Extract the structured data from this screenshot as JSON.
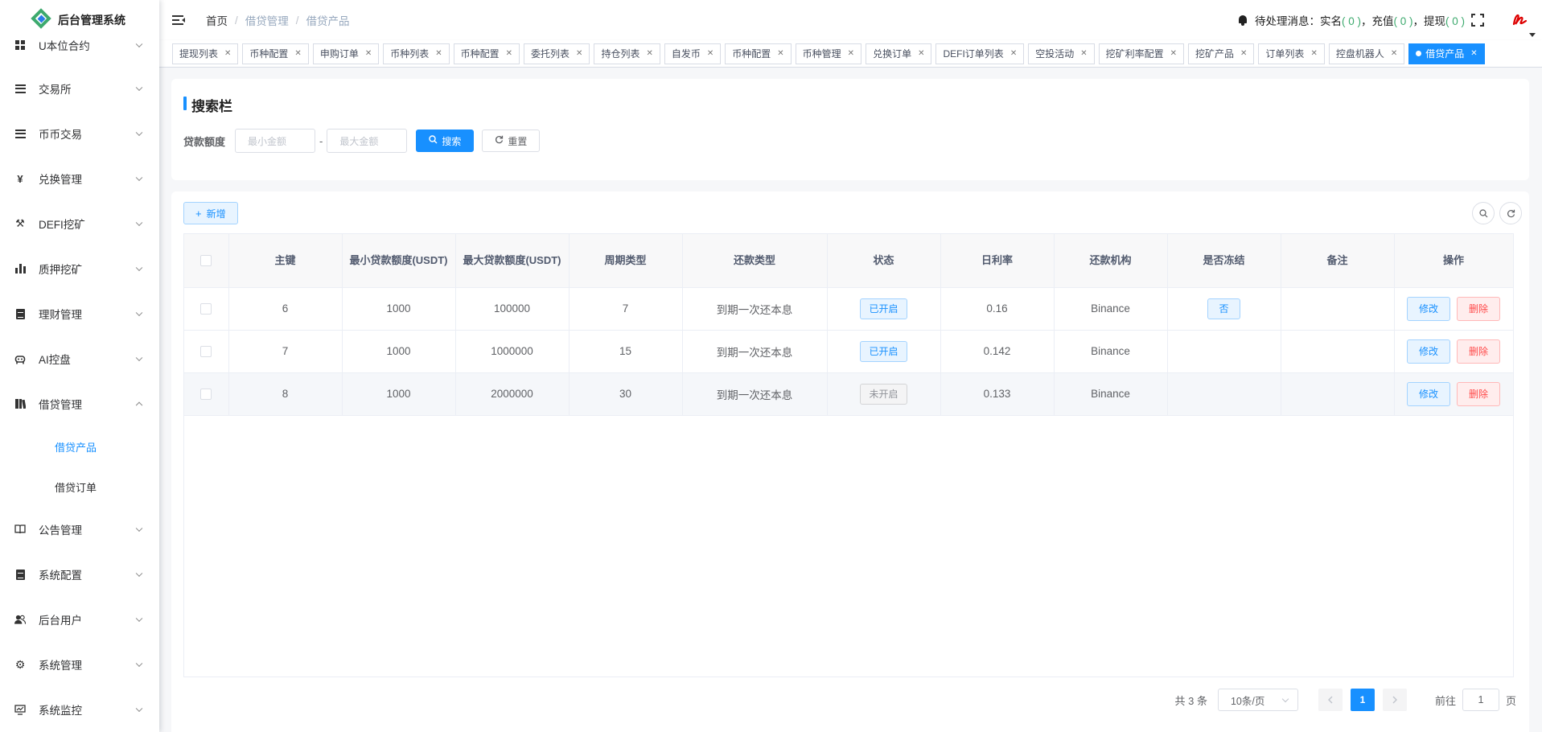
{
  "app": {
    "title": "后台管理系统"
  },
  "sidebar": {
    "items": [
      {
        "label": "U本位合约",
        "icon": "grid-icon"
      },
      {
        "label": "交易所",
        "icon": "list-icon"
      },
      {
        "label": "币币交易",
        "icon": "list-icon"
      },
      {
        "label": "兑换管理",
        "icon": "yen-icon"
      },
      {
        "label": "DEFI挖矿",
        "icon": "pickaxe-icon"
      },
      {
        "label": "质押挖矿",
        "icon": "bar-chart-icon"
      },
      {
        "label": "理财管理",
        "icon": "document-icon"
      },
      {
        "label": "AI控盘",
        "icon": "robot-icon"
      },
      {
        "label": "借贷管理",
        "icon": "book-icon"
      },
      {
        "label": "公告管理",
        "icon": "open-book-icon"
      },
      {
        "label": "系统配置",
        "icon": "document-icon"
      },
      {
        "label": "后台用户",
        "icon": "users-icon"
      },
      {
        "label": "系统管理",
        "icon": "gear-icon"
      },
      {
        "label": "系统监控",
        "icon": "monitor-icon"
      }
    ],
    "submenu": [
      {
        "label": "借贷产品"
      },
      {
        "label": "借贷订单"
      }
    ]
  },
  "header": {
    "breadcrumb": [
      "首页",
      "借贷管理",
      "借贷产品"
    ],
    "pending_label": "待处理消息：",
    "realname_label": "实名",
    "realname_count": "( 0 )",
    "sep1": "，",
    "recharge_label": "充值",
    "recharge_count": "( 0 )",
    "sep2": "，",
    "withdraw_label": "提现",
    "withdraw_count": "( 0 )"
  },
  "tags": [
    "提现列表",
    "币种配置",
    "申购订单",
    "币种列表",
    "币种配置",
    "委托列表",
    "持仓列表",
    "自发币",
    "币种配置",
    "币种管理",
    "兑换订单",
    "DEFI订单列表",
    "空投活动",
    "挖矿利率配置",
    "挖矿产品",
    "订单列表",
    "控盘机器人",
    "借贷产品"
  ],
  "search": {
    "title": "搜索栏",
    "label": "贷款额度",
    "min_placeholder": "最小金额",
    "dash": "-",
    "max_placeholder": "最大金额",
    "search_btn": "搜索",
    "reset_btn": "重置"
  },
  "toolbar": {
    "add_btn": "新增"
  },
  "table": {
    "headers": [
      "主键",
      "最小贷款额度(USDT)",
      "最大贷款额度(USDT)",
      "周期类型",
      "还款类型",
      "状态",
      "日利率",
      "还款机构",
      "是否冻结",
      "备注",
      "操作"
    ],
    "rows": [
      {
        "id": "6",
        "min": "1000",
        "max": "100000",
        "period": "7",
        "repay": "到期一次还本息",
        "status": "已开启",
        "status_on": true,
        "rate": "0.16",
        "org": "Binance",
        "frozen": "否",
        "remark": ""
      },
      {
        "id": "7",
        "min": "1000",
        "max": "1000000",
        "period": "15",
        "repay": "到期一次还本息",
        "status": "已开启",
        "status_on": true,
        "rate": "0.142",
        "org": "Binance",
        "frozen": "",
        "remark": ""
      },
      {
        "id": "8",
        "min": "1000",
        "max": "2000000",
        "period": "30",
        "repay": "到期一次还本息",
        "status": "未开启",
        "status_on": false,
        "rate": "0.133",
        "org": "Binance",
        "frozen": "",
        "remark": ""
      }
    ],
    "edit_btn": "修改",
    "delete_btn": "删除"
  },
  "pagination": {
    "total": "共 3 条",
    "page_size": "10条/页",
    "current": "1",
    "goto_prefix": "前往",
    "goto_value": "1",
    "goto_suffix": "页"
  },
  "colors": {
    "primary": "#1890ff",
    "danger": "#ff4949",
    "success": "#3daa6e"
  }
}
